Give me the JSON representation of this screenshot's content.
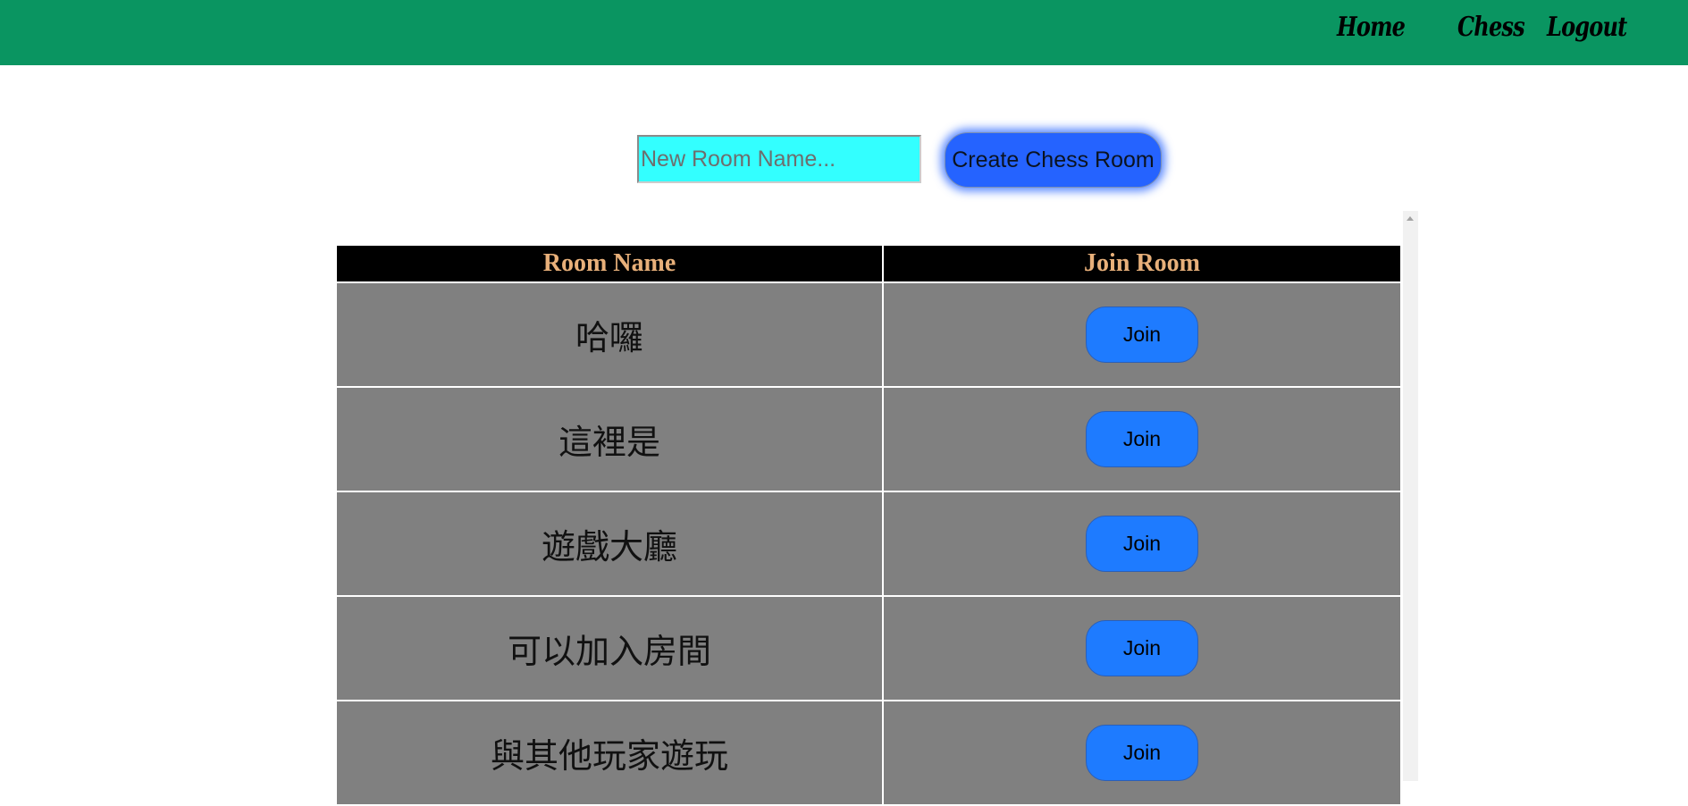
{
  "nav": {
    "home": "Home",
    "chess": "Chess",
    "logout": "Logout"
  },
  "create": {
    "placeholder": "New Room Name...",
    "button_label": "Create Chess Room"
  },
  "table": {
    "headers": [
      "Room Name",
      "Join Room"
    ],
    "rows": [
      {
        "name": "哈囉",
        "action": "Join"
      },
      {
        "name": "這裡是",
        "action": "Join"
      },
      {
        "name": "遊戲大廳",
        "action": "Join"
      },
      {
        "name": "可以加入房間",
        "action": "Join"
      },
      {
        "name": "與其他玩家遊玩",
        "action": "Join"
      }
    ]
  },
  "colors": {
    "topbar": "#0a9561",
    "input_bg": "#33ffff",
    "create_button": "#2563ff",
    "header_bg": "#000000",
    "header_text": "#e8b07a",
    "row_bg": "#808080",
    "join_button": "#1e7bff"
  }
}
